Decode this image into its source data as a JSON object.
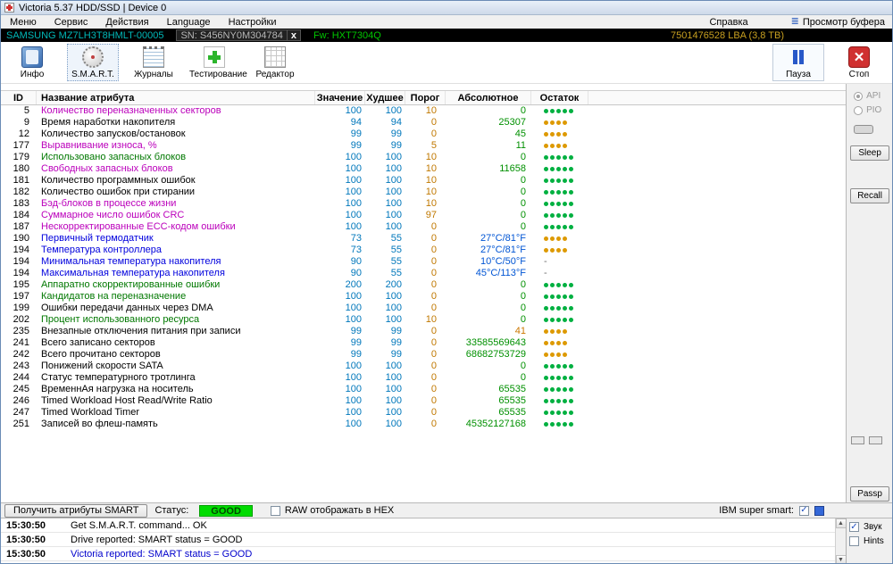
{
  "window": {
    "title": "Victoria 5.37 HDD/SSD | Device 0"
  },
  "menubar": {
    "items": [
      "Меню",
      "Сервис",
      "Действия",
      "Language",
      "Настройки"
    ],
    "help": "Справка",
    "buffer_view": "Просмотр буфера"
  },
  "device_bar": {
    "model": "SAMSUNG MZ7LH3T8HMLT-00005",
    "serial": "SN: S456NY0M304784",
    "close_label": "x",
    "firmware": "Fw: HXT7304Q",
    "capacity": "7501476528 LBA (3,8 TB)"
  },
  "toolbar": {
    "buttons": [
      {
        "id": "info",
        "label": "Инфо",
        "icon": "info-book-icon",
        "active": false
      },
      {
        "id": "smart",
        "label": "S.M.A.R.T.",
        "icon": "smart-icon",
        "active": true
      },
      {
        "id": "journals",
        "label": "Журналы",
        "icon": "journals-icon",
        "active": false
      },
      {
        "id": "test",
        "label": "Тестирование",
        "icon": "test-cross-icon",
        "active": false
      },
      {
        "id": "editor",
        "label": "Редактор",
        "icon": "editor-grid-icon",
        "active": false
      }
    ],
    "pause_label": "Пауза",
    "stop_label": "Стоп",
    "stop_glyph": "✕"
  },
  "table": {
    "columns": [
      "ID",
      "Название атрибута",
      "Значение",
      "Худшее",
      "Порог",
      "Абсолютное",
      "Остаток"
    ],
    "rows": [
      {
        "id": "5",
        "name": "Количество переназначенных секторов",
        "name_color": "magenta",
        "value": "100",
        "worst": "100",
        "threshold": "10",
        "absolute": "0",
        "abs_color": "green",
        "health": {
          "dots": 5,
          "color": "green"
        }
      },
      {
        "id": "9",
        "name": "Время наработки накопителя",
        "name_color": "black",
        "value": "94",
        "worst": "94",
        "threshold": "0",
        "absolute": "25307",
        "abs_color": "green",
        "health": {
          "dots": 4,
          "color": "orange"
        }
      },
      {
        "id": "12",
        "name": "Количество запусков/остановок",
        "name_color": "black",
        "value": "99",
        "worst": "99",
        "threshold": "0",
        "absolute": "45",
        "abs_color": "green",
        "health": {
          "dots": 4,
          "color": "orange"
        }
      },
      {
        "id": "177",
        "name": "Выравнивание износа, %",
        "name_color": "magenta",
        "value": "99",
        "worst": "99",
        "threshold": "5",
        "absolute": "11",
        "abs_color": "green",
        "health": {
          "dots": 4,
          "color": "orange"
        }
      },
      {
        "id": "179",
        "name": "Использовано запасных блоков",
        "name_color": "green",
        "value": "100",
        "worst": "100",
        "threshold": "10",
        "absolute": "0",
        "abs_color": "green",
        "health": {
          "dots": 5,
          "color": "green"
        }
      },
      {
        "id": "180",
        "name": "Свободных запасных блоков",
        "name_color": "magenta",
        "value": "100",
        "worst": "100",
        "threshold": "10",
        "absolute": "11658",
        "abs_color": "green",
        "health": {
          "dots": 5,
          "color": "green"
        }
      },
      {
        "id": "181",
        "name": "Количество программных ошибок",
        "name_color": "black",
        "value": "100",
        "worst": "100",
        "threshold": "10",
        "absolute": "0",
        "abs_color": "green",
        "health": {
          "dots": 5,
          "color": "green"
        }
      },
      {
        "id": "182",
        "name": "Количество ошибок при стирании",
        "name_color": "black",
        "value": "100",
        "worst": "100",
        "threshold": "10",
        "absolute": "0",
        "abs_color": "green",
        "health": {
          "dots": 5,
          "color": "green"
        }
      },
      {
        "id": "183",
        "name": "Бэд-блоков в процессе жизни",
        "name_color": "magenta",
        "value": "100",
        "worst": "100",
        "threshold": "10",
        "absolute": "0",
        "abs_color": "green",
        "health": {
          "dots": 5,
          "color": "green"
        }
      },
      {
        "id": "184",
        "name": "Суммарное число ошибок CRC",
        "name_color": "magenta",
        "value": "100",
        "worst": "100",
        "threshold": "97",
        "absolute": "0",
        "abs_color": "green",
        "health": {
          "dots": 5,
          "color": "green"
        }
      },
      {
        "id": "187",
        "name": "Нескорректированные ECC-кодом ошибки",
        "name_color": "magenta",
        "value": "100",
        "worst": "100",
        "threshold": "0",
        "absolute": "0",
        "abs_color": "green",
        "health": {
          "dots": 5,
          "color": "green"
        }
      },
      {
        "id": "190",
        "name": "Первичный термодатчик",
        "name_color": "blue",
        "value": "73",
        "worst": "55",
        "threshold": "0",
        "absolute": "27°C/81°F",
        "abs_color": "blue",
        "health": {
          "dots": 4,
          "color": "orange"
        }
      },
      {
        "id": "194",
        "name": "Температура контроллера",
        "name_color": "blue",
        "value": "73",
        "worst": "55",
        "threshold": "0",
        "absolute": "27°C/81°F",
        "abs_color": "blue",
        "health": {
          "dots": 4,
          "color": "orange"
        }
      },
      {
        "id": "194",
        "name": "Минимальная температура накопителя",
        "name_color": "blue",
        "value": "90",
        "worst": "55",
        "threshold": "0",
        "absolute": "10°C/50°F",
        "abs_color": "blue",
        "health": {
          "dash": true
        }
      },
      {
        "id": "194",
        "name": "Максимальная температура накопителя",
        "name_color": "blue",
        "value": "90",
        "worst": "55",
        "threshold": "0",
        "absolute": "45°C/113°F",
        "abs_color": "blue",
        "health": {
          "dash": true
        }
      },
      {
        "id": "195",
        "name": "Аппаратно скорректированные ошибки",
        "name_color": "green",
        "value": "200",
        "worst": "200",
        "threshold": "0",
        "absolute": "0",
        "abs_color": "green",
        "health": {
          "dots": 5,
          "color": "green"
        }
      },
      {
        "id": "197",
        "name": "Кандидатов на переназначение",
        "name_color": "green",
        "value": "100",
        "worst": "100",
        "threshold": "0",
        "absolute": "0",
        "abs_color": "green",
        "health": {
          "dots": 5,
          "color": "green"
        }
      },
      {
        "id": "199",
        "name": "Ошибки передачи данных через DMA",
        "name_color": "black",
        "value": "100",
        "worst": "100",
        "threshold": "0",
        "absolute": "0",
        "abs_color": "green",
        "health": {
          "dots": 5,
          "color": "green"
        }
      },
      {
        "id": "202",
        "name": "Процент использованного ресурса",
        "name_color": "green",
        "value": "100",
        "worst": "100",
        "threshold": "10",
        "absolute": "0",
        "abs_color": "green",
        "health": {
          "dots": 5,
          "color": "green"
        }
      },
      {
        "id": "235",
        "name": "Внезапные отключения питания при записи",
        "name_color": "black",
        "value": "99",
        "worst": "99",
        "threshold": "0",
        "absolute": "41",
        "abs_color": "orange",
        "health": {
          "dots": 4,
          "color": "orange"
        }
      },
      {
        "id": "241",
        "name": "Всего записано секторов",
        "name_color": "black",
        "value": "99",
        "worst": "99",
        "threshold": "0",
        "absolute": "33585569643",
        "abs_color": "green",
        "health": {
          "dots": 4,
          "color": "orange"
        }
      },
      {
        "id": "242",
        "name": "Всего прочитано секторов",
        "name_color": "black",
        "value": "99",
        "worst": "99",
        "threshold": "0",
        "absolute": "68682753729",
        "abs_color": "green",
        "health": {
          "dots": 4,
          "color": "orange"
        }
      },
      {
        "id": "243",
        "name": "Понижений скорости SATA",
        "name_color": "black",
        "value": "100",
        "worst": "100",
        "threshold": "0",
        "absolute": "0",
        "abs_color": "green",
        "health": {
          "dots": 5,
          "color": "green"
        }
      },
      {
        "id": "244",
        "name": "Статус температурного тротлинга",
        "name_color": "black",
        "value": "100",
        "worst": "100",
        "threshold": "0",
        "absolute": "0",
        "abs_color": "green",
        "health": {
          "dots": 5,
          "color": "green"
        }
      },
      {
        "id": "245",
        "name": "ВременнАя нагрузка на носитель",
        "name_color": "black",
        "value": "100",
        "worst": "100",
        "threshold": "0",
        "absolute": "65535",
        "abs_color": "green",
        "health": {
          "dots": 5,
          "color": "green"
        }
      },
      {
        "id": "246",
        "name": "Timed Workload Host Read/Write Ratio",
        "name_color": "black",
        "value": "100",
        "worst": "100",
        "threshold": "0",
        "absolute": "65535",
        "abs_color": "green",
        "health": {
          "dots": 5,
          "color": "green"
        }
      },
      {
        "id": "247",
        "name": "Timed Workload Timer",
        "name_color": "black",
        "value": "100",
        "worst": "100",
        "threshold": "0",
        "absolute": "65535",
        "abs_color": "green",
        "health": {
          "dots": 5,
          "color": "green"
        }
      },
      {
        "id": "251",
        "name": "Записей во флеш-память",
        "name_color": "black",
        "value": "100",
        "worst": "100",
        "threshold": "0",
        "absolute": "45352127168",
        "abs_color": "green",
        "health": {
          "dots": 5,
          "color": "green"
        }
      }
    ]
  },
  "side_panel": {
    "api_label": "API",
    "pio_label": "PIO",
    "sleep_label": "Sleep",
    "recall_label": "Recall",
    "passp_label": "Passp"
  },
  "status_bar": {
    "get_smart_label": "Получить атрибуты SMART",
    "status_label": "Статус:",
    "status_value": "GOOD",
    "raw_hex_label": "RAW отображать в HEX",
    "ibm_label": "IBM super smart:"
  },
  "log": {
    "entries": [
      {
        "time": "15:30:50",
        "text": "Get S.M.A.R.T. command... OK",
        "color": "black"
      },
      {
        "time": "15:30:50",
        "text": "Drive reported: SMART status = GOOD",
        "color": "black"
      },
      {
        "time": "15:30:50",
        "text": "Victoria reported: SMART status = GOOD",
        "color": "blue"
      }
    ],
    "sound_label": "Звук",
    "hints_label": "Hints"
  },
  "colors": {
    "status_good_bg": "#00dc00",
    "value_blue": "#0077bb",
    "threshold_orange": "#c07800",
    "absolute_green": "#009000",
    "name_magenta": "#bb00bb",
    "name_green": "#007800",
    "name_blue": "#0000dd"
  }
}
